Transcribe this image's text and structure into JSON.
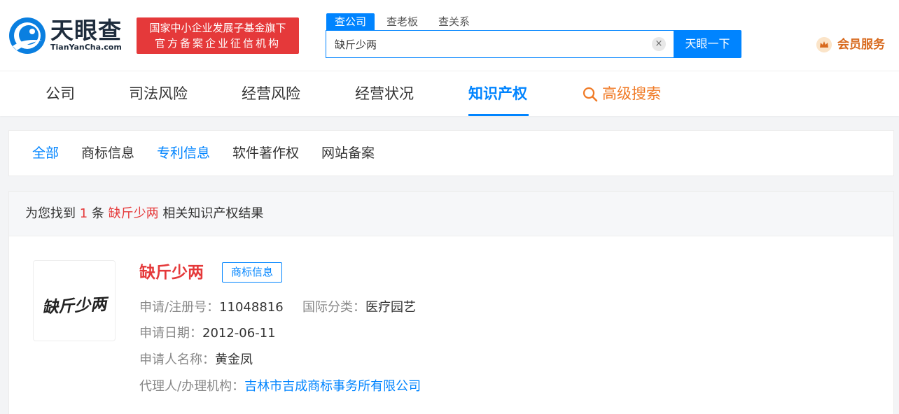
{
  "header": {
    "logo_cn": "天眼查",
    "logo_en": "TianYanCha.com",
    "badge_line1": "国家中小企业发展子基金旗下",
    "badge_line2": "官方备案企业征信机构",
    "search_tabs": [
      "查公司",
      "查老板",
      "查关系"
    ],
    "search_value": "缺斤少两",
    "search_button": "天眼一下",
    "clear_symbol": "×",
    "vip_label": "会员服务"
  },
  "nav": {
    "items": [
      "公司",
      "司法风险",
      "经营风险",
      "经营状况",
      "知识产权"
    ],
    "active_index": 4,
    "advanced": "高级搜索"
  },
  "filters": {
    "tabs": [
      "全部",
      "商标信息",
      "专利信息",
      "软件著作权",
      "网站备案"
    ],
    "active": [
      "全部",
      "专利信息"
    ]
  },
  "summary": {
    "prefix": "为您找到",
    "count": "1",
    "unit": "条",
    "keyword": "缺斤少两",
    "suffix": "相关知识产权结果"
  },
  "result": {
    "image_text": "缺斤少两",
    "title": "缺斤少两",
    "tag": "商标信息",
    "reg_label": "申请/注册号：",
    "reg_value": "11048816",
    "class_label": "国际分类：",
    "class_value": "医疗园艺",
    "date_label": "申请日期：",
    "date_value": "2012-06-11",
    "applicant_label": "申请人名称：",
    "applicant_value": "黄金凤",
    "agent_label": "代理人/办理机构：",
    "agent_value": "吉林市吉成商标事务所有限公司"
  },
  "colors": {
    "brand_blue": "#0084ff",
    "brand_red": "#e5393a",
    "orange": "#f07a25"
  }
}
